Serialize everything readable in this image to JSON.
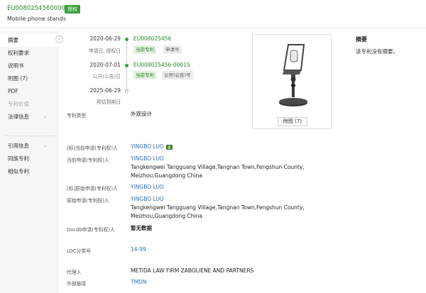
{
  "header": {
    "pub_no": "EU008025456000015",
    "status_badge": "授权",
    "title": "Mobile phone stands"
  },
  "sidebar": {
    "items": [
      {
        "label": "摘要"
      },
      {
        "label": "权利要求"
      },
      {
        "label": "说明书"
      },
      {
        "label": "附图 (7)"
      },
      {
        "label": "PDF"
      },
      {
        "label": "专利价值"
      },
      {
        "label": "法律信息"
      },
      {
        "label": "引用信息"
      },
      {
        "label": "同族专利"
      },
      {
        "label": "相似专利"
      }
    ]
  },
  "timeline": [
    {
      "date": "2020-06-29",
      "label": "申请日, 授权日",
      "number": "EU008025456",
      "tags": [
        "当前专利",
        "申请号"
      ]
    },
    {
      "date": "2020-07-01",
      "label": "公开(公告)日",
      "number": "EU008025456-0001S",
      "tags": [
        "当前专利",
        "公开(公告)号"
      ]
    },
    {
      "date": "2025-06-29",
      "label": "预估到期日",
      "number": "",
      "tags": []
    }
  ],
  "image_panel": {
    "caption": "附图 (7)"
  },
  "abstract": {
    "title": "摘要",
    "text": "该专利没有摘要。"
  },
  "fields": {
    "patent_type_label": "专利类型",
    "patent_type_value": "外观设计",
    "std_current_applicant_label": "[标]当前申请(专利权)人",
    "std_current_applicant_value": "YINGBO LUO",
    "current_applicant_label": "当前申请(专利权)人",
    "current_applicant_name": "YINGBO LUO",
    "current_applicant_addr1": "Tangkengwei Tangguang Village,Tangnan Town,Fengshun County,",
    "current_applicant_addr2": "Meizhou,Guangdong China",
    "std_original_applicant_label": "[标]原始申请(专利权)人",
    "std_original_applicant_value": "YINGBO LUO",
    "original_applicant_label": "原始申请(专利权)人",
    "original_applicant_name": "YINGBO LUO",
    "original_applicant_addr1": "Tangkengwei Tangguang Village,Tangnan Town,Fengshun County,",
    "original_applicant_addr2": "Meizhou,Guangdong China",
    "docdb_label": "Docdb申请(专利权)人",
    "docdb_value": "暂无数据",
    "loc_label": "LOC分类号",
    "loc_value": "14-99",
    "agent_label": "代理人",
    "agent_value": "METIDA LAW FIRM ZABOLIENE AND PARTNERS",
    "external_link_label": "外部链接",
    "external_link_value": "TMDN"
  },
  "colors": {
    "accent_green": "#3aa03a",
    "link_blue": "#2c6fba"
  }
}
